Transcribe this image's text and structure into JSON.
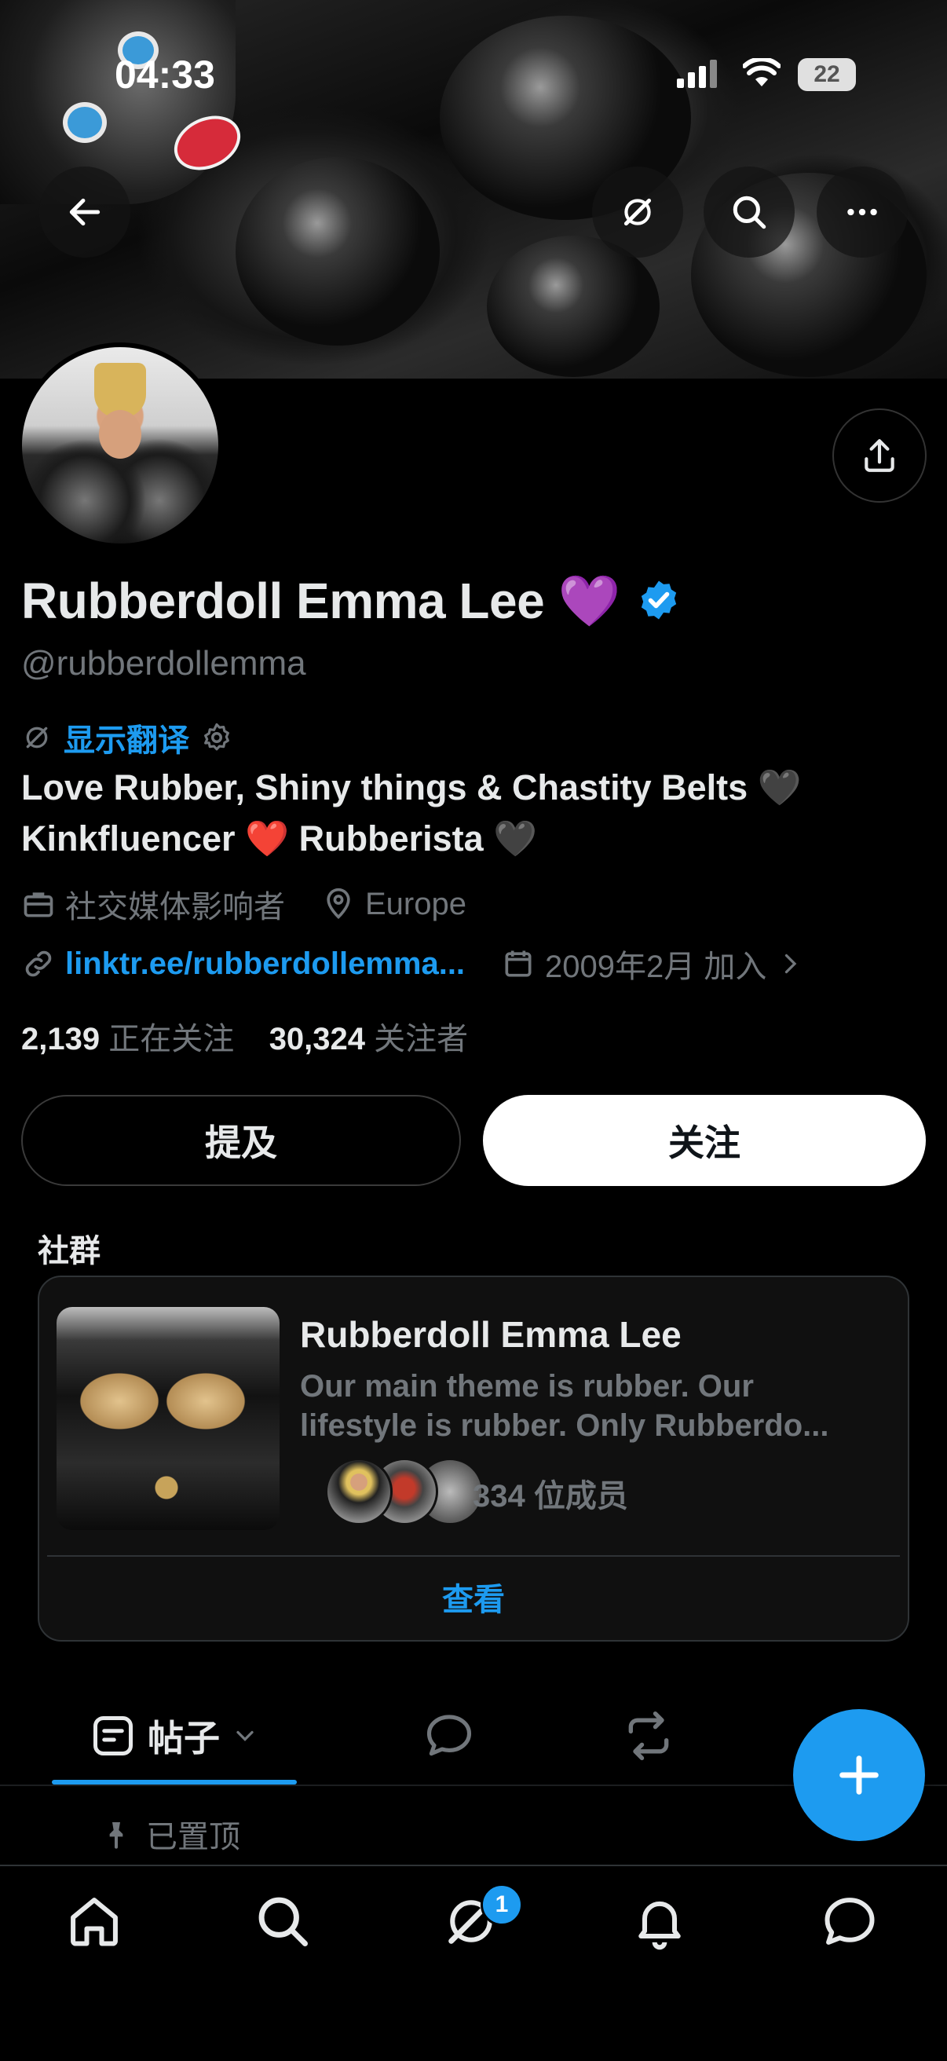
{
  "status_bar": {
    "time": "04:33",
    "battery": "22"
  },
  "profile": {
    "name": "Rubberdoll Emma Lee",
    "name_emoji": "💜",
    "handle": "@rubberdollemma",
    "translate_label": "显示翻译",
    "bio_line1": "Love Rubber, Shiny things & Chastity Belts 🖤",
    "bio_line2": "Kinkfluencer ❤️ Rubberista 🖤",
    "category": "社交媒体影响者",
    "location": "Europe",
    "link": "linktr.ee/rubberdollemma...",
    "joined": "2009年2月 加入",
    "following_count": "2,139",
    "following_label": "正在关注",
    "followers_count": "30,324",
    "followers_label": "关注者"
  },
  "actions": {
    "mention_label": "提及",
    "follow_label": "关注"
  },
  "community": {
    "section_title": "社群",
    "name": "Rubberdoll Emma Lee",
    "desc_line1": "Our main theme is rubber. Our",
    "desc_line2": "lifestyle is rubber. Only Rubberdo...",
    "members": "334 位成员",
    "view_label": "查看"
  },
  "tabs": {
    "posts_label": "帖子"
  },
  "pinned_label": "已置顶",
  "nav": {
    "messages_badge": "1"
  },
  "colors": {
    "accent": "#1d9bf0",
    "background": "#000000",
    "muted": "#71767b"
  }
}
